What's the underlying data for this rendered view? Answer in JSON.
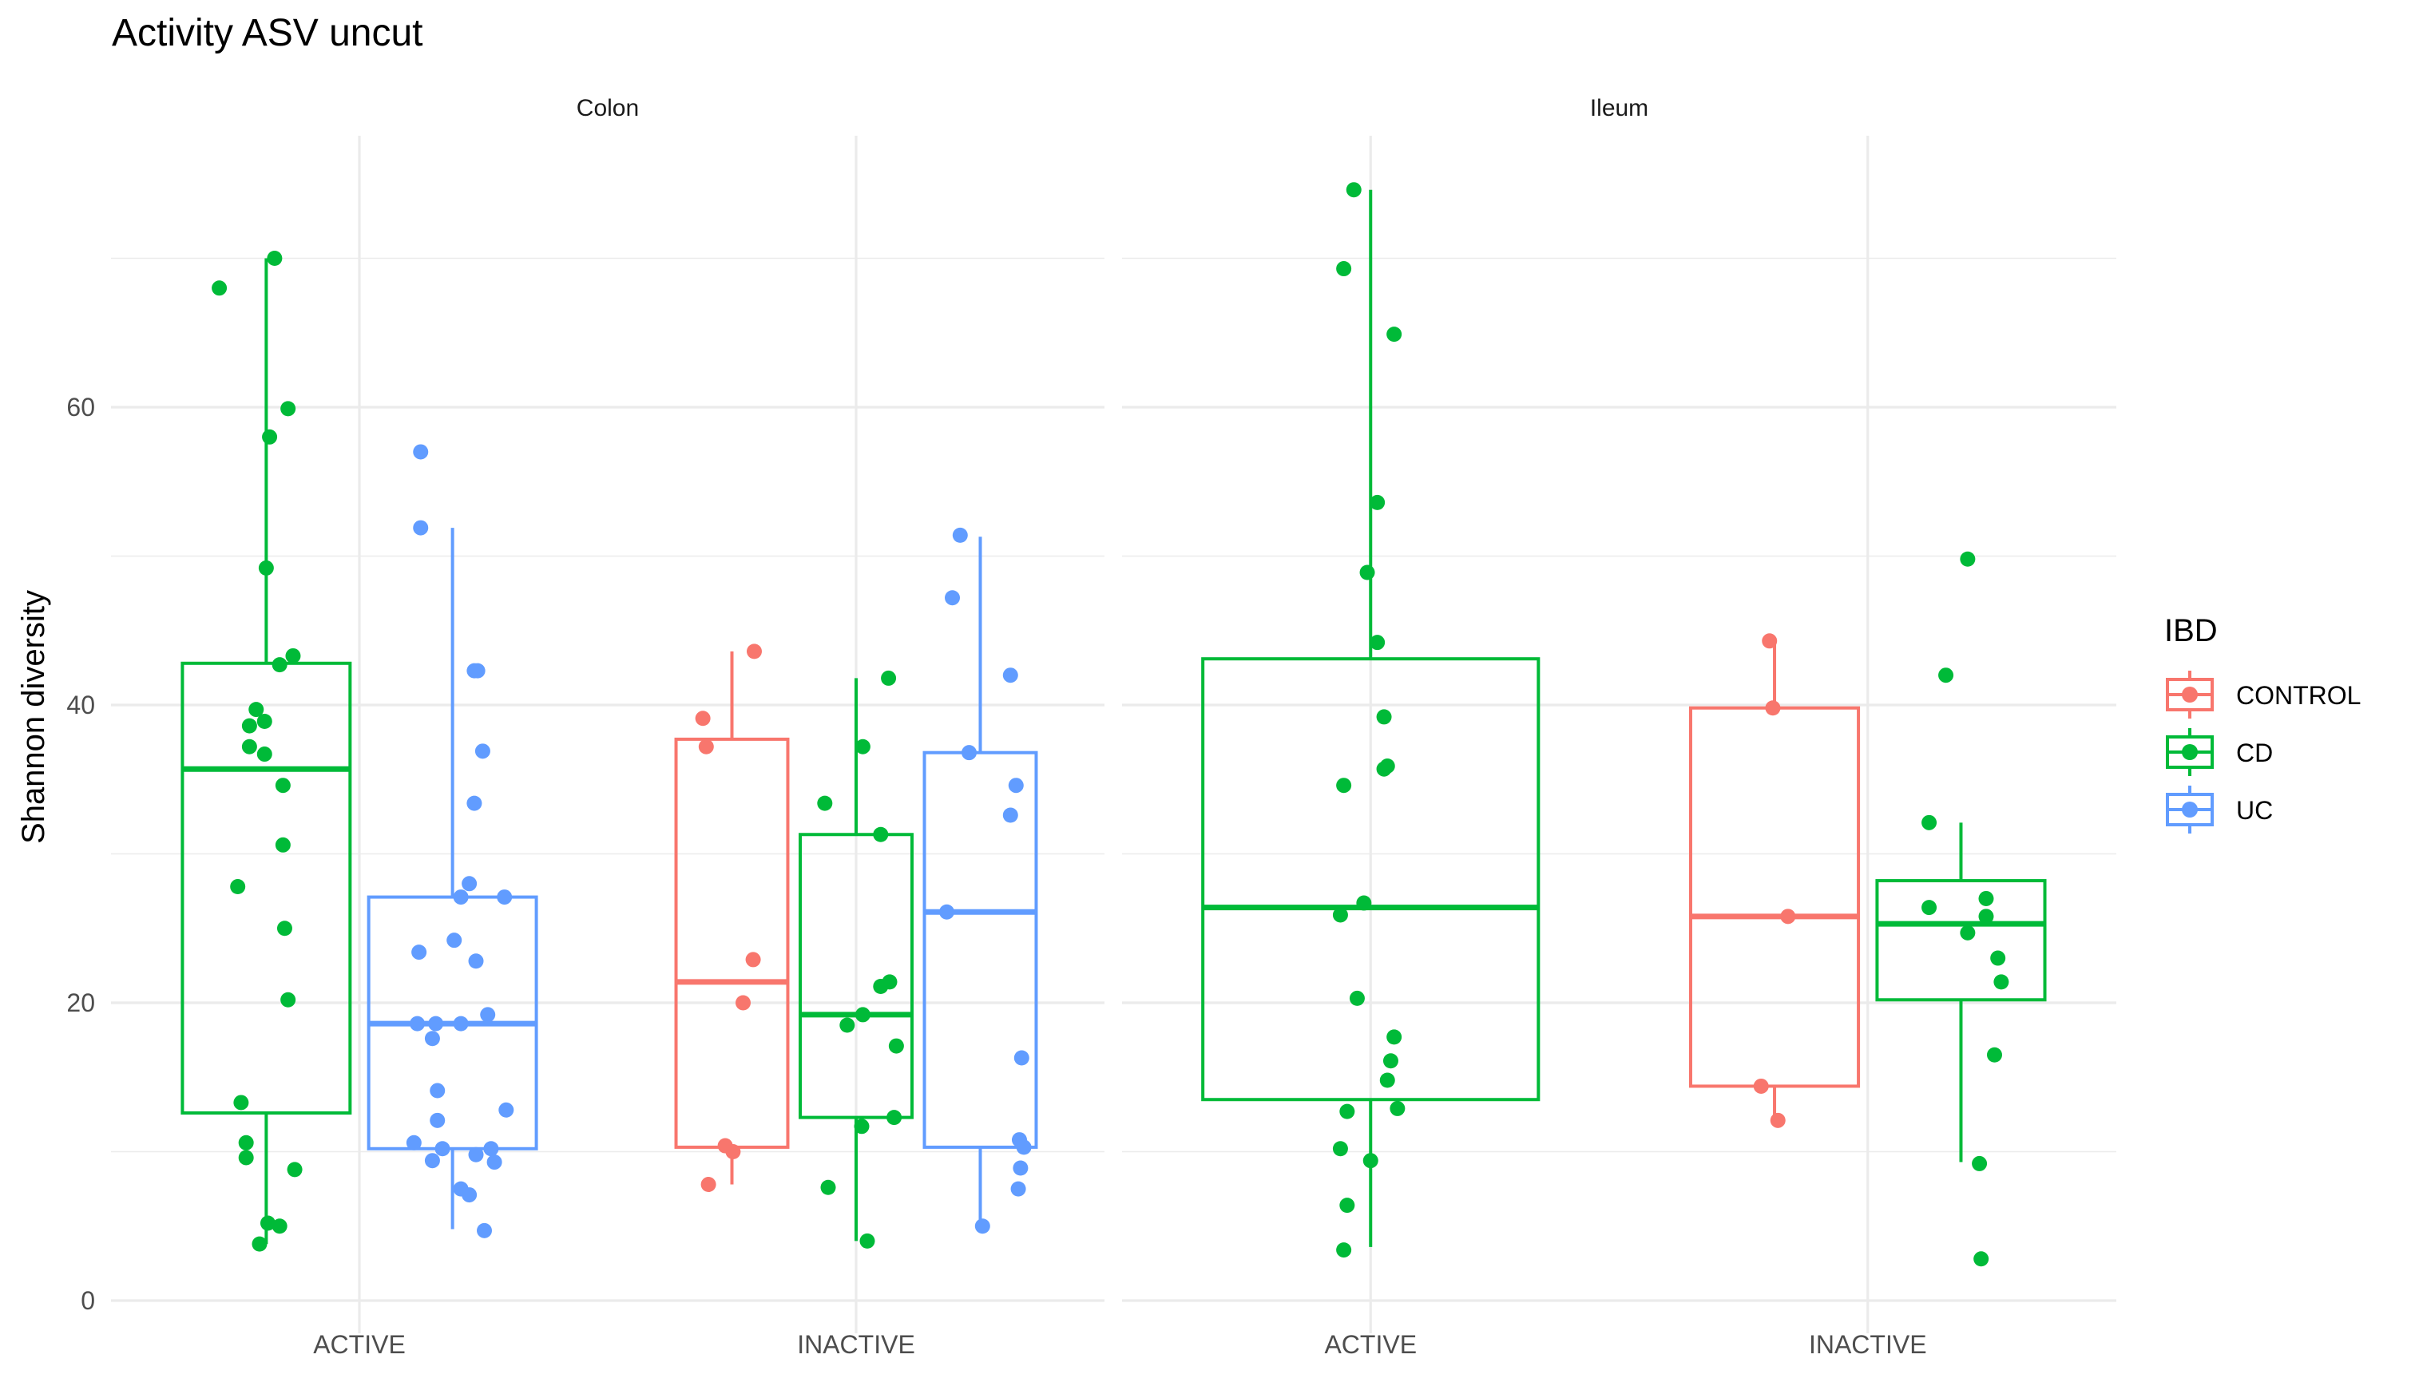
{
  "chart_data": {
    "type": "boxplot",
    "title": "Activity ASV uncut",
    "xlabel": "",
    "ylabel": "Shannon diversity",
    "ylim": [
      -3.5,
      78
    ],
    "yticks": [
      0,
      20,
      40,
      60
    ],
    "grid": true,
    "legend": {
      "title": "IBD",
      "position": "right",
      "entries": [
        {
          "name": "CONTROL",
          "color": "#F8766D"
        },
        {
          "name": "CD",
          "color": "#00BA38"
        },
        {
          "name": "UC",
          "color": "#619CFF"
        }
      ]
    },
    "categories": [
      "ACTIVE",
      "INACTIVE"
    ],
    "facets": [
      {
        "name": "Colon",
        "groups": [
          {
            "category": "ACTIVE",
            "series": [
              {
                "name": "CD",
                "box": {
                  "whisker_low": 3.8,
                  "q1": 12.6,
                  "median": 35.7,
                  "q3": 42.8,
                  "whisker_high": 70.0
                },
                "points": [
                  70.0,
                  68.0,
                  59.9,
                  58.0,
                  49.2,
                  43.3,
                  42.7,
                  39.7,
                  38.9,
                  38.6,
                  37.2,
                  36.7,
                  34.6,
                  30.6,
                  27.8,
                  25.0,
                  20.2,
                  13.3,
                  10.6,
                  9.6,
                  8.8,
                  5.2,
                  5.0,
                  3.8
                ],
                "jitter": [
                  0.05,
                  -0.28,
                  0.13,
                  0.02,
                  0.0,
                  0.16,
                  0.08,
                  -0.06,
                  -0.01,
                  -0.1,
                  -0.1,
                  -0.01,
                  0.1,
                  0.1,
                  -0.17,
                  0.11,
                  0.13,
                  -0.15,
                  -0.12,
                  -0.12,
                  0.17,
                  0.01,
                  0.08,
                  -0.04
                ]
              },
              {
                "name": "UC",
                "box": {
                  "whisker_low": 4.8,
                  "q1": 10.2,
                  "median": 18.6,
                  "q3": 27.1,
                  "whisker_high": 51.9
                },
                "points": [
                  57.0,
                  51.9,
                  42.3,
                  42.3,
                  36.9,
                  33.4,
                  28.0,
                  27.1,
                  27.1,
                  24.2,
                  23.4,
                  22.8,
                  19.2,
                  18.6,
                  18.6,
                  18.6,
                  17.6,
                  14.1,
                  12.8,
                  12.1,
                  10.6,
                  10.2,
                  10.2,
                  9.8,
                  9.4,
                  9.3,
                  7.5,
                  7.1,
                  4.7
                ],
                "jitter": [
                  -0.19,
                  -0.19,
                  0.13,
                  0.15,
                  0.18,
                  0.13,
                  0.1,
                  0.05,
                  0.31,
                  0.01,
                  -0.2,
                  0.14,
                  0.21,
                  -0.21,
                  -0.1,
                  0.05,
                  -0.12,
                  -0.09,
                  0.32,
                  -0.09,
                  -0.23,
                  -0.06,
                  0.23,
                  0.14,
                  -0.12,
                  0.25,
                  0.05,
                  0.1,
                  0.19
                ]
              }
            ]
          },
          {
            "category": "INACTIVE",
            "series": [
              {
                "name": "CONTROL",
                "box": {
                  "whisker_low": 7.8,
                  "q1": 10.3,
                  "median": 21.4,
                  "q3": 37.7,
                  "whisker_high": 43.6
                },
                "points": [
                  43.6,
                  39.1,
                  37.2,
                  22.9,
                  20.0,
                  10.4,
                  10.0,
                  7.8
                ],
                "jitter": [
                  0.2,
                  -0.26,
                  -0.23,
                  0.19,
                  0.1,
                  -0.06,
                  0.01,
                  -0.21
                ]
              },
              {
                "name": "CD",
                "box": {
                  "whisker_low": 4.0,
                  "q1": 12.3,
                  "median": 19.2,
                  "q3": 31.3,
                  "whisker_high": 41.8
                },
                "points": [
                  41.8,
                  37.2,
                  33.4,
                  31.3,
                  21.4,
                  21.1,
                  19.2,
                  18.5,
                  17.1,
                  12.3,
                  11.7,
                  7.6,
                  4.0
                ],
                "jitter": [
                  0.29,
                  0.06,
                  -0.28,
                  0.22,
                  0.3,
                  0.22,
                  0.06,
                  -0.08,
                  0.36,
                  0.34,
                  0.05,
                  -0.25,
                  0.1
                ]
              },
              {
                "name": "UC",
                "box": {
                  "whisker_low": 5.1,
                  "q1": 10.3,
                  "median": 26.1,
                  "q3": 36.8,
                  "whisker_high": 51.3
                },
                "points": [
                  51.4,
                  47.2,
                  42.0,
                  36.8,
                  34.6,
                  32.6,
                  26.1,
                  16.3,
                  10.8,
                  10.3,
                  8.9,
                  7.5,
                  5.0
                ],
                "jitter": [
                  0.32,
                  0.25,
                  0.77,
                  0.4,
                  0.82,
                  0.77,
                  0.2,
                  0.87,
                  0.85,
                  0.89,
                  0.86,
                  0.84,
                  0.52
                ]
              }
            ]
          }
        ]
      },
      {
        "name": "Ileum",
        "groups": [
          {
            "category": "ACTIVE",
            "series": [
              {
                "name": "CD",
                "box": {
                  "whisker_low": 3.6,
                  "q1": 13.5,
                  "median": 26.4,
                  "q3": 43.1,
                  "whisker_high": 74.6
                },
                "points": [
                  74.6,
                  69.3,
                  64.9,
                  53.6,
                  48.9,
                  44.2,
                  39.2,
                  35.9,
                  35.7,
                  34.6,
                  26.7,
                  25.9,
                  20.3,
                  17.7,
                  16.1,
                  14.8,
                  12.9,
                  12.7,
                  10.2,
                  9.4,
                  6.4,
                  3.4
                ],
                "jitter": [
                  -0.05,
                  -0.08,
                  0.07,
                  0.02,
                  -0.01,
                  0.02,
                  0.04,
                  0.05,
                  0.04,
                  -0.08,
                  -0.02,
                  -0.09,
                  -0.04,
                  0.07,
                  0.06,
                  0.05,
                  0.08,
                  -0.07,
                  -0.09,
                  0.0,
                  -0.07,
                  -0.08
                ]
              }
            ]
          },
          {
            "category": "INACTIVE",
            "series": [
              {
                "name": "CONTROL",
                "box": {
                  "whisker_low": 12.1,
                  "q1": 14.4,
                  "median": 25.8,
                  "q3": 39.8,
                  "whisker_high": 44.3
                },
                "points": [
                  44.3,
                  39.8,
                  25.8,
                  14.4,
                  12.1
                ],
                "jitter": [
                  -0.03,
                  -0.01,
                  0.08,
                  -0.08,
                  0.02
                ]
              },
              {
                "name": "CD",
                "box": {
                  "whisker_low": 9.3,
                  "q1": 20.2,
                  "median": 25.3,
                  "q3": 28.2,
                  "whisker_high": 32.1
                },
                "points": [
                  49.8,
                  42.0,
                  32.1,
                  27.0,
                  26.4,
                  25.8,
                  24.7,
                  23.0,
                  21.4,
                  16.5,
                  9.2,
                  2.8
                ],
                "jitter": [
                  0.04,
                  -0.09,
                  -0.19,
                  0.15,
                  -0.19,
                  0.15,
                  0.04,
                  0.22,
                  0.24,
                  0.2,
                  0.11,
                  0.12
                ]
              }
            ]
          }
        ]
      }
    ]
  }
}
